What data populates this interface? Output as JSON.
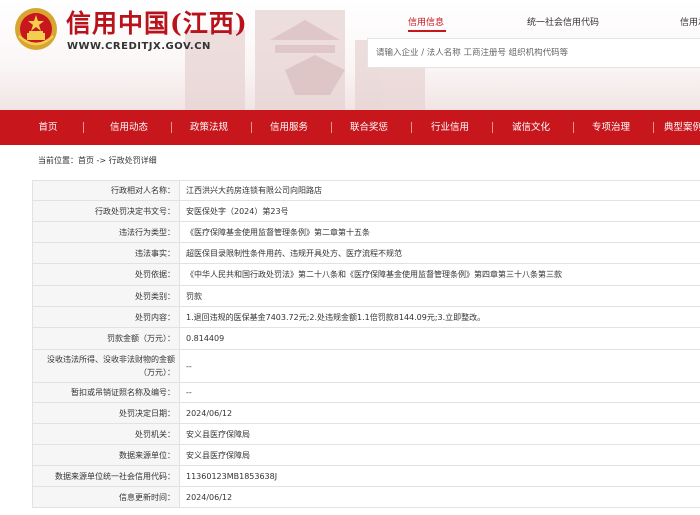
{
  "header": {
    "title": "信用中国(江西)",
    "url": "WWW.CREDITJX.GOV.CN",
    "top_links": [
      "信用信息",
      "统一社会信用代码",
      "信用承诺"
    ],
    "active_top_link": "信用信息",
    "search_placeholder": "请输入企业 / 法人名称 工商注册号 组织机构代码等"
  },
  "nav": {
    "items": [
      "首页",
      "信用动态",
      "政策法规",
      "信用服务",
      "联合奖惩",
      "行业信用",
      "诚信文化",
      "专项治理",
      "典型案例"
    ]
  },
  "breadcrumb": "当前位置：首页 -> 行政处罚详细",
  "detail": {
    "rows": [
      {
        "label": "行政相对人名称：",
        "value": "江西洪兴大药房连锁有限公司向阳路店"
      },
      {
        "label": "行政处罚决定书文号：",
        "value": "安医保处字（2024）第23号"
      },
      {
        "label": "违法行为类型：",
        "value": "《医疗保障基金使用监督管理条例》第二章第十五条"
      },
      {
        "label": "违法事实：",
        "value": "超医保目录限制性条件用药、违规开具处方、医疗流程不规范"
      },
      {
        "label": "处罚依据：",
        "value": "《中华人民共和国行政处罚法》第二十八条和《医疗保障基金使用监督管理条例》第四章第三十八条第三款"
      },
      {
        "label": "处罚类别：",
        "value": "罚款"
      },
      {
        "label": "处罚内容：",
        "value": "1.退回违规的医保基金7403.72元;2.处违规金额1.1倍罚款8144.09元;3.立即整改。"
      },
      {
        "label": "罚款金额（万元）：",
        "value": "0.814409"
      },
      {
        "label": "没收违法所得、没收非法财物的金额（万元）：",
        "value": "--"
      },
      {
        "label": "暂扣或吊销证照名称及编号：",
        "value": "--"
      },
      {
        "label": "处罚决定日期：",
        "value": "2024/06/12"
      },
      {
        "label": "处罚机关：",
        "value": "安义县医疗保障局"
      },
      {
        "label": "数据来源单位：",
        "value": "安义县医疗保障局"
      },
      {
        "label": "数据来源单位统一社会信用代码：",
        "value": "11360123MB1853638J"
      },
      {
        "label": "信息更新时间：",
        "value": "2024/06/12"
      }
    ]
  },
  "colors": {
    "brand_red": "#c8161d",
    "title_red": "#b8121b",
    "label_bg": "#f6f6f6",
    "border": "#e2e2e2"
  },
  "icons": [
    "national-emblem-icon"
  ]
}
